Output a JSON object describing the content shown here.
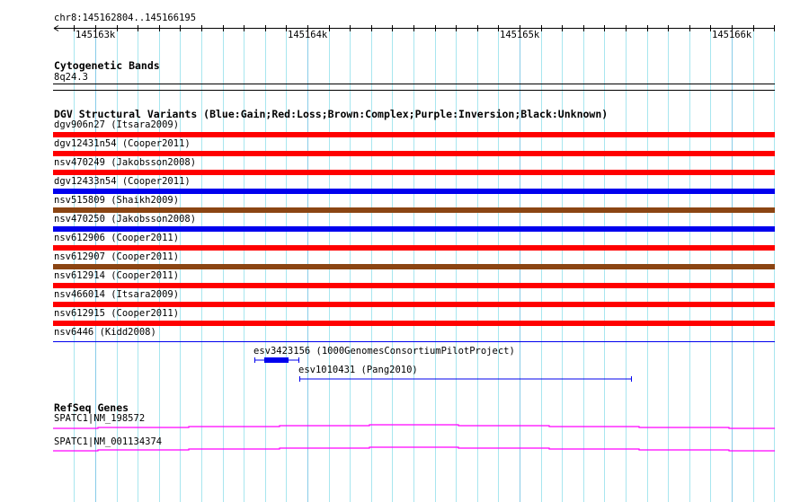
{
  "ruler": {
    "location": "chr8:145162804..145166195",
    "ticks": [
      "145163k",
      "145164k",
      "145165k",
      "145166k"
    ]
  },
  "cytoband": {
    "title": "Cytogenetic Bands",
    "band": "8q24.3"
  },
  "dgv": {
    "title": "DGV Structural Variants (Blue:Gain;Red:Loss;Brown:Complex;Purple:Inversion;Black:Unknown)",
    "colors": {
      "gain": "#0000ee",
      "loss": "#ff0000",
      "complex": "#8b4513"
    },
    "items": [
      {
        "label": "dgv906n27 (Itsara2009)",
        "type": "loss"
      },
      {
        "label": "dgv12431n54 (Cooper2011)",
        "type": "loss"
      },
      {
        "label": "nsv470249 (Jakobsson2008)",
        "type": "loss"
      },
      {
        "label": "dgv12433n54 (Cooper2011)",
        "type": "gain"
      },
      {
        "label": "nsv515809 (Shaikh2009)",
        "type": "complex"
      },
      {
        "label": "nsv470250 (Jakobsson2008)",
        "type": "gain"
      },
      {
        "label": "nsv612906 (Cooper2011)",
        "type": "loss"
      },
      {
        "label": "nsv612907 (Cooper2011)",
        "type": "complex"
      },
      {
        "label": "nsv612914 (Cooper2011)",
        "type": "loss"
      },
      {
        "label": "nsv466014 (Itsara2009)",
        "type": "loss"
      },
      {
        "label": "nsv612915 (Cooper2011)",
        "type": "loss"
      },
      {
        "label": "nsv6446 (Kidd2008)",
        "type": "gain"
      }
    ],
    "small": [
      {
        "label": "esv3423156 (1000GenomesConsortiumPilotProject)"
      },
      {
        "label": "esv1010431 (Pang2010)"
      }
    ]
  },
  "refseq": {
    "title": "RefSeq Genes",
    "color": "#ff00ff",
    "genes": [
      "SPATC1|NM_198572",
      "SPATC1|NM_001134374"
    ]
  }
}
